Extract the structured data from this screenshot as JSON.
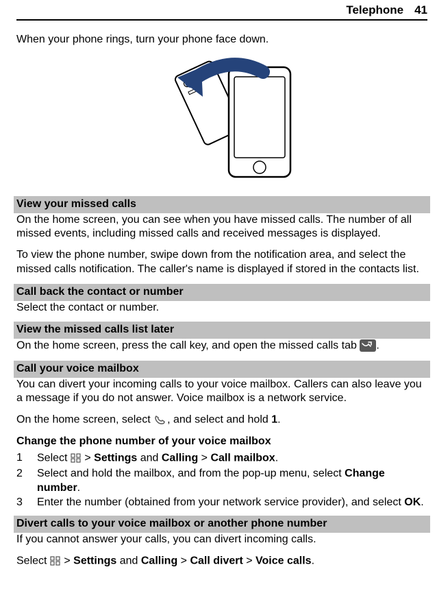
{
  "header": {
    "title": "Telephone",
    "page": "41"
  },
  "intro": "When your phone rings, turn your phone face down.",
  "sec_missed": {
    "head": "View your missed calls",
    "p1": "On the home screen, you can see when you have missed calls. The number of all missed events, including missed calls and received messages is displayed.",
    "p2": "To view the phone number, swipe down from the notification area, and select the missed calls notification. The caller's name is displayed if stored in the contacts list."
  },
  "sec_callback": {
    "head": "Call back the contact or number",
    "p": "Select the contact or number."
  },
  "sec_later": {
    "head": "View the missed calls list later",
    "p_pre": "On the home screen, press the call key, and open the missed calls tab ",
    "p_post": "."
  },
  "sec_voicemail": {
    "head": "Call your voice mailbox",
    "p1": "You can divert your incoming calls to your voice mailbox. Callers can also leave you a message if you do not answer. Voice mailbox is a network service.",
    "p2_pre": "On the home screen, select ",
    "p2_mid": ", and select and hold ",
    "p2_bold": "1",
    "p2_post": "."
  },
  "sec_change": {
    "head": "Change the phone number of your voice mailbox",
    "s1_pre": "Select ",
    "s1_1": " > ",
    "s1_b1": "Settings",
    "s1_2": " and ",
    "s1_b2": "Calling",
    "s1_3": " > ",
    "s1_b3": "Call mailbox",
    "s1_4": ".",
    "s2_pre": "Select and hold the mailbox, and from the pop-up menu, select ",
    "s2_b": "Change number",
    "s2_post": ".",
    "s3_pre": "Enter the number (obtained from your network service provider), and select ",
    "s3_b": "OK",
    "s3_post": "."
  },
  "sec_divert": {
    "head": "Divert calls to your voice mailbox or another phone number",
    "p": "If you cannot answer your calls, you can divert incoming calls.",
    "p2_pre": "Select ",
    "p2_1": " > ",
    "p2_b1": "Settings",
    "p2_2": " and ",
    "p2_b2": "Calling",
    "p2_3": " > ",
    "p2_b3": "Call divert",
    "p2_4": " > ",
    "p2_b4": "Voice calls",
    "p2_5": "."
  },
  "nums": {
    "n1": "1",
    "n2": "2",
    "n3": "3"
  }
}
